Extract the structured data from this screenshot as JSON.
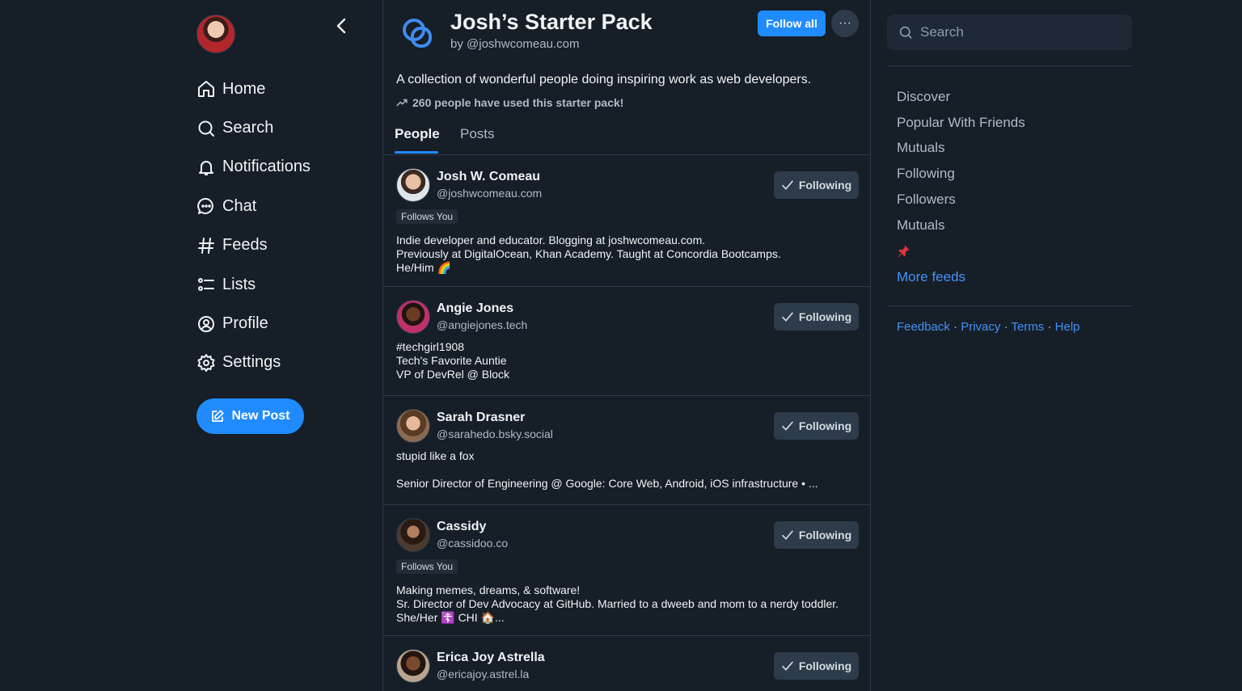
{
  "nav": {
    "items": [
      {
        "label": "Home",
        "icon": "home-icon"
      },
      {
        "label": "Search",
        "icon": "search-icon"
      },
      {
        "label": "Notifications",
        "icon": "bell-icon"
      },
      {
        "label": "Chat",
        "icon": "chat-icon"
      },
      {
        "label": "Feeds",
        "icon": "hash-icon"
      },
      {
        "label": "Lists",
        "icon": "list-icon"
      },
      {
        "label": "Profile",
        "icon": "profile-icon"
      },
      {
        "label": "Settings",
        "icon": "gear-icon"
      }
    ],
    "new_post_label": "New Post"
  },
  "pack": {
    "title": "Josh’s Starter Pack",
    "by": "by @joshwcomeau.com",
    "follow_all_label": "Follow all",
    "description": "A collection of wonderful people doing inspiring work as web developers.",
    "used_text": "260 people have used this starter pack!",
    "tabs": [
      "People",
      "Posts"
    ],
    "active_tab": "People"
  },
  "people": [
    {
      "name": "Josh W. Comeau",
      "handle": "@joshwcomeau.com",
      "follows_you": "Follows You",
      "bio": "Indie developer and educator. Blogging at joshwcomeau.com.\nPreviously at DigitalOcean, Khan Academy. Taught at Concordia Bootcamps.\nHe/Him 🌈",
      "button": "Following"
    },
    {
      "name": "Angie Jones",
      "handle": "@angiejones.tech",
      "follows_you": "",
      "bio": "#techgirl1908\nTech's Favorite Auntie\nVP of DevRel @ Block",
      "button": "Following"
    },
    {
      "name": "Sarah Drasner",
      "handle": "@sarahedo.bsky.social",
      "follows_you": "",
      "bio": "stupid like a fox\n\nSenior Director of Engineering @ Google: Core Web, Android, iOS infrastructure • ...",
      "button": "Following"
    },
    {
      "name": "Cassidy",
      "handle": "@cassidoo.co",
      "follows_you": "Follows You",
      "bio": "Making memes, dreams, & software!\nSr. Director of Dev Advocacy at GitHub. Married to a dweeb and mom to a nerdy toddler.\nShe/Her ☦️ CHI 🏠...",
      "button": "Following"
    },
    {
      "name": "Erica Joy Astrella",
      "handle": "@ericajoy.astrel.la",
      "follows_you": "",
      "bio": "",
      "button": "Following"
    }
  ],
  "right": {
    "search_placeholder": "Search",
    "feeds": [
      "Discover",
      "Popular With Friends",
      "Mutuals",
      "Following",
      "Followers",
      "Mutuals"
    ],
    "pin_icon": "pin-icon",
    "more_feeds_label": "More feeds",
    "footer": [
      "Feedback",
      "Privacy",
      "Terms",
      "Help"
    ],
    "footer_separator": " · "
  },
  "colors": {
    "background": "#161e27",
    "accent": "#208bfe",
    "link": "#4393f7",
    "muted": "#aebbc9",
    "border": "#2e3b4a"
  }
}
